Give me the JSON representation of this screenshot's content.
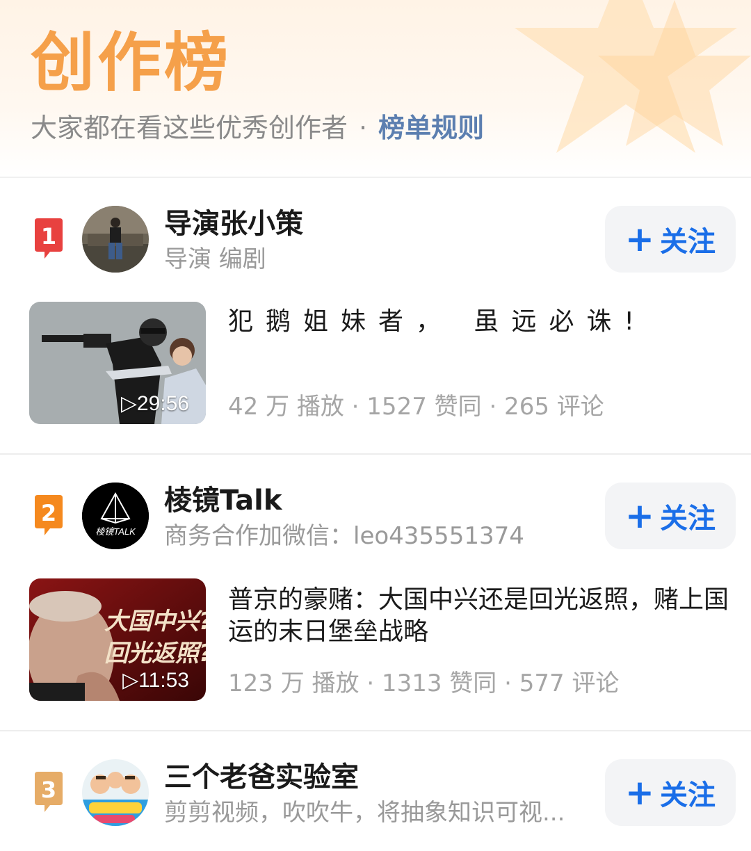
{
  "header": {
    "title": "创作榜",
    "subtitle": "大家都在看这些优秀创作者",
    "separator": "·",
    "rules_link": "榜单规则"
  },
  "colors": {
    "accent_orange": "#f5a04a",
    "link_blue": "#1a6ee8",
    "rules_blue": "#5c7fb0",
    "rank1": "#e8413f",
    "rank2": "#f5891e",
    "rank3": "#e6ac67"
  },
  "creators": [
    {
      "rank": "1",
      "name": "导演张小策",
      "desc": "导演 编剧",
      "follow_label": "关注",
      "video": {
        "title": "犯鹅姐妹者， 虽远必诛!",
        "duration": "▷29:56",
        "stats": "42 万 播放 · 1527 赞同 · 265 评论"
      }
    },
    {
      "rank": "2",
      "name": "棱镜Talk",
      "avatar_text": "棱镜TALK",
      "desc": "商务合作加微信：leo435551374",
      "follow_label": "关注",
      "video": {
        "title": "普京的豪赌：大国中兴还是回光返照，赌上国运的末日堡垒战略",
        "duration": "▷11:53",
        "thumb_text_1": "大国中兴?",
        "thumb_text_2": "回光返照?",
        "stats": "123 万 播放 · 1313 赞同 · 577 评论"
      }
    },
    {
      "rank": "3",
      "name": "三个老爸实验室",
      "desc": "剪剪视频，吹吹牛，将抽象知识可视...",
      "follow_label": "关注"
    }
  ]
}
